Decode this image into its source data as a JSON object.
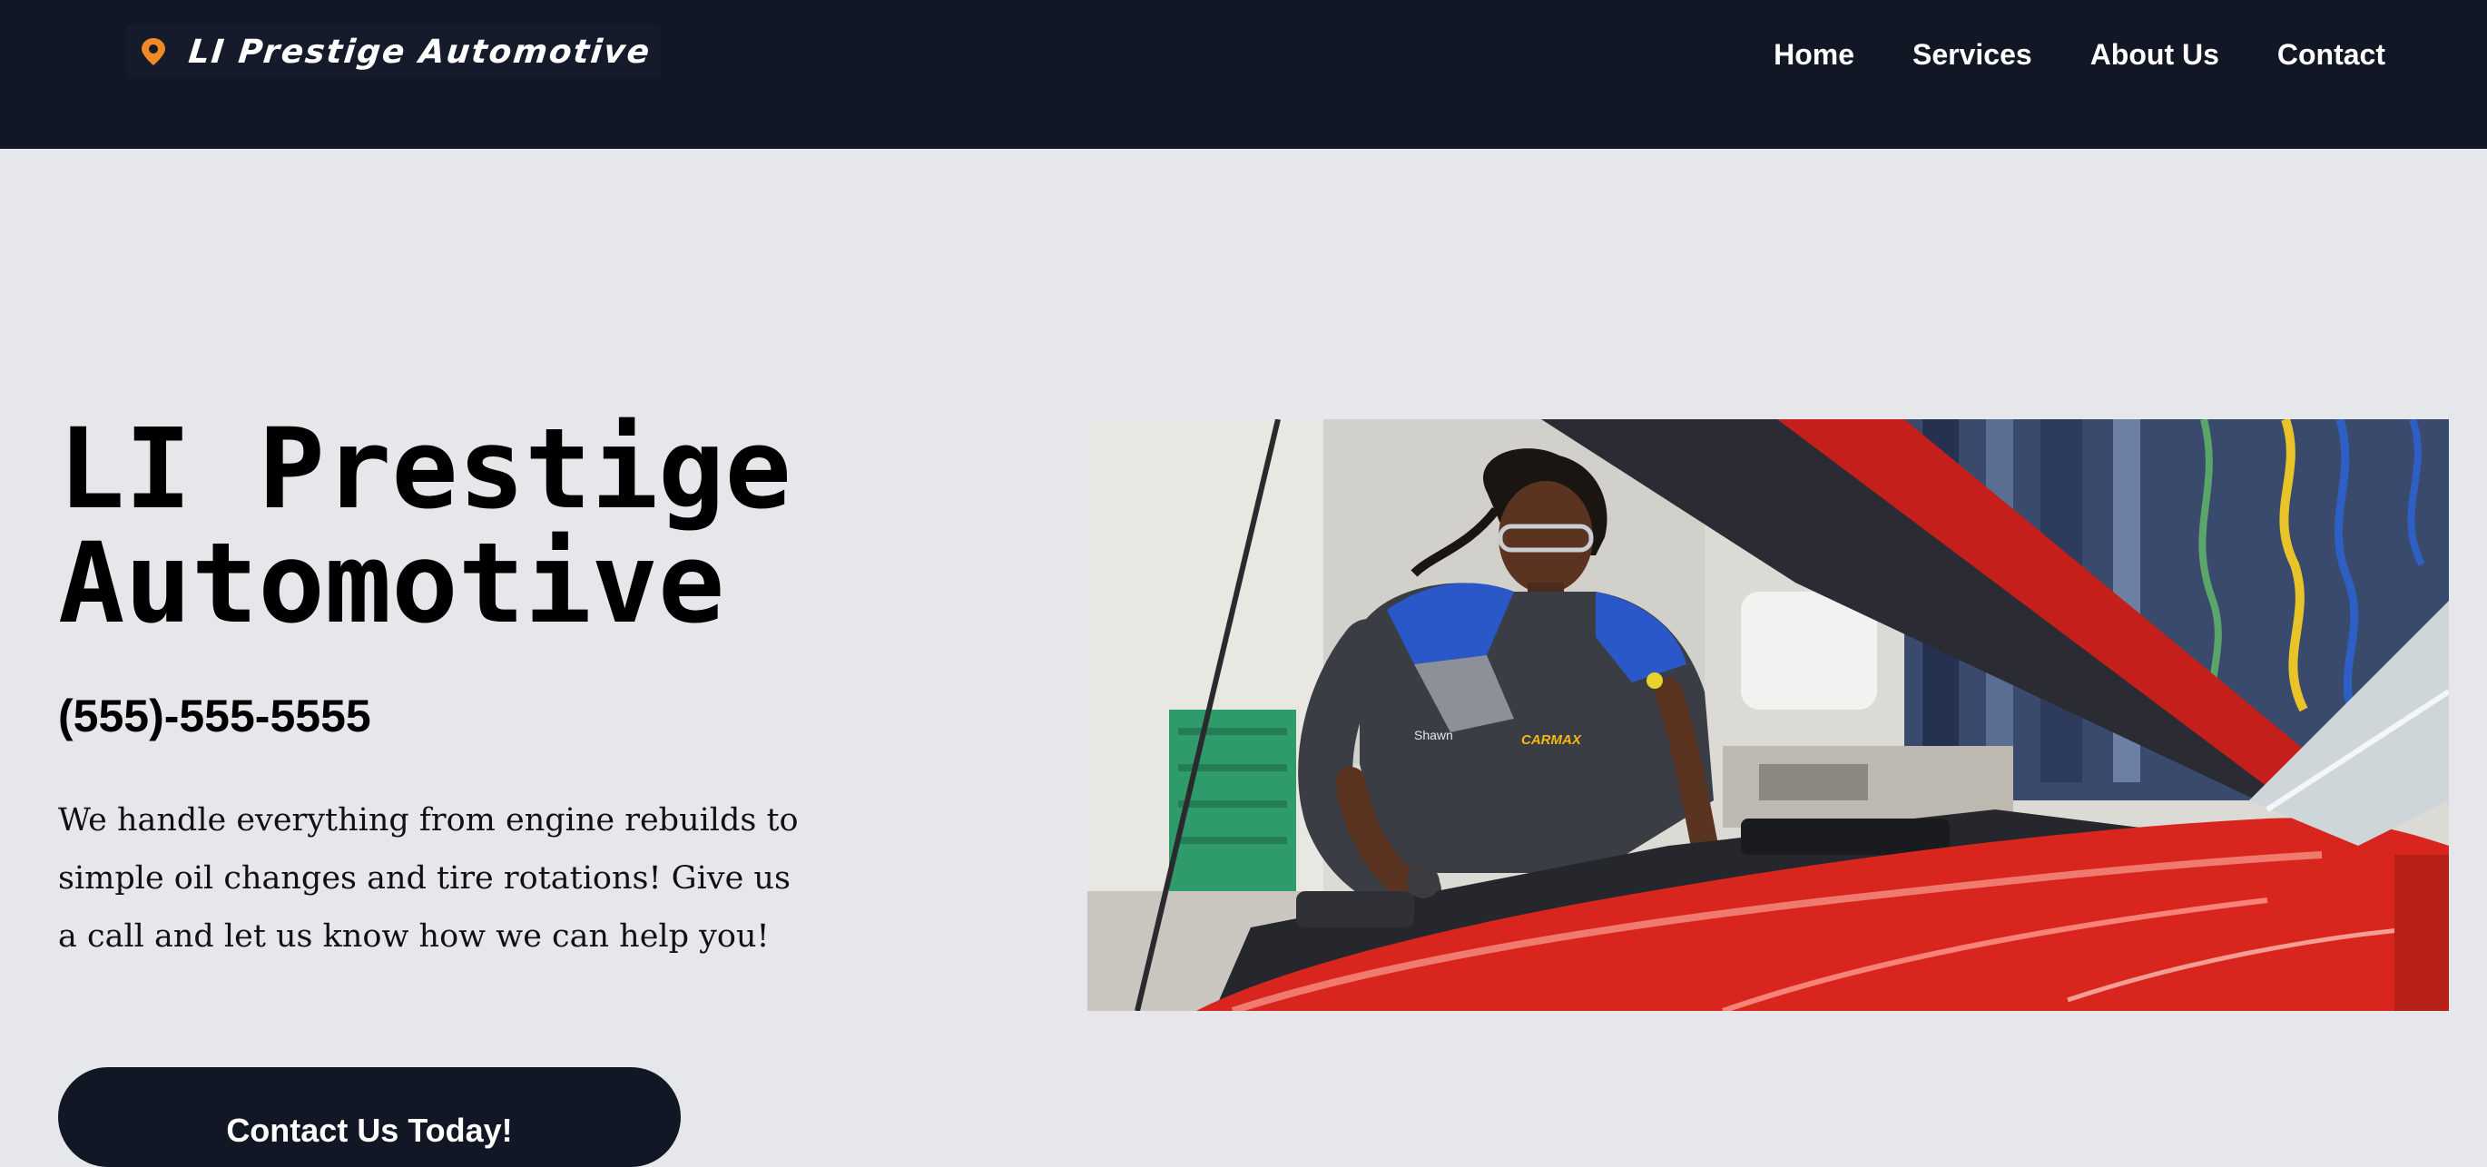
{
  "navbar": {
    "brand": "LI Prestige Automotive",
    "logo_icon": "location-pin-icon",
    "links": [
      {
        "label": "Home"
      },
      {
        "label": "Services"
      },
      {
        "label": "About Us"
      },
      {
        "label": "Contact"
      }
    ]
  },
  "hero": {
    "title_line1": "LI Prestige",
    "title_line2": "Automotive",
    "phone": "(555)-555-5555",
    "description": "We handle everything from engine rebuilds to simple oil changes and tire rotations! Give us a call and let us know how we can help you!",
    "cta_label": "Contact Us Today!",
    "image": {
      "name_tag": "Shawn",
      "shirt_logo": "CARMAX"
    }
  },
  "colors": {
    "navbar_bg": "#121726",
    "page_bg": "#e5e7eb",
    "logo_accent": "#f08a24",
    "car_red": "#d8261e",
    "button_bg": "#121726"
  }
}
